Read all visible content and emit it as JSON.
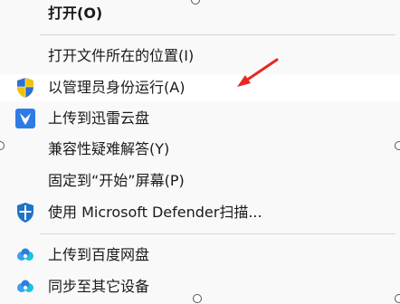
{
  "context_menu": {
    "items": [
      {
        "label": "打开(O)",
        "icon": null,
        "bold": true
      },
      {
        "label": "打开文件所在的位置(I)",
        "icon": null
      },
      {
        "label": "以管理员身份运行(A)",
        "icon": "uac-shield-icon",
        "highlighted": true
      },
      {
        "label": "上传到迅雷云盘",
        "icon": "xunlei-icon"
      },
      {
        "label": "兼容性疑难解答(Y)",
        "icon": null
      },
      {
        "label": "固定到“开始”屏幕(P)",
        "icon": null
      },
      {
        "label": "使用 Microsoft Defender扫描...",
        "icon": "defender-shield-icon"
      },
      {
        "label": "上传到百度网盘",
        "icon": "baidu-netdisk-icon"
      },
      {
        "label": "同步至其它设备",
        "icon": "baidu-sync-icon"
      }
    ]
  },
  "colors": {
    "menu_background": "#f9f9f9",
    "separator": "#d4d4d4",
    "annotation_arrow": "#e8281e",
    "defender_blue": "#1e73c8",
    "xunlei_blue": "#2f7be5",
    "uac_blue": "#2f6fd0",
    "uac_yellow": "#f2c200"
  }
}
